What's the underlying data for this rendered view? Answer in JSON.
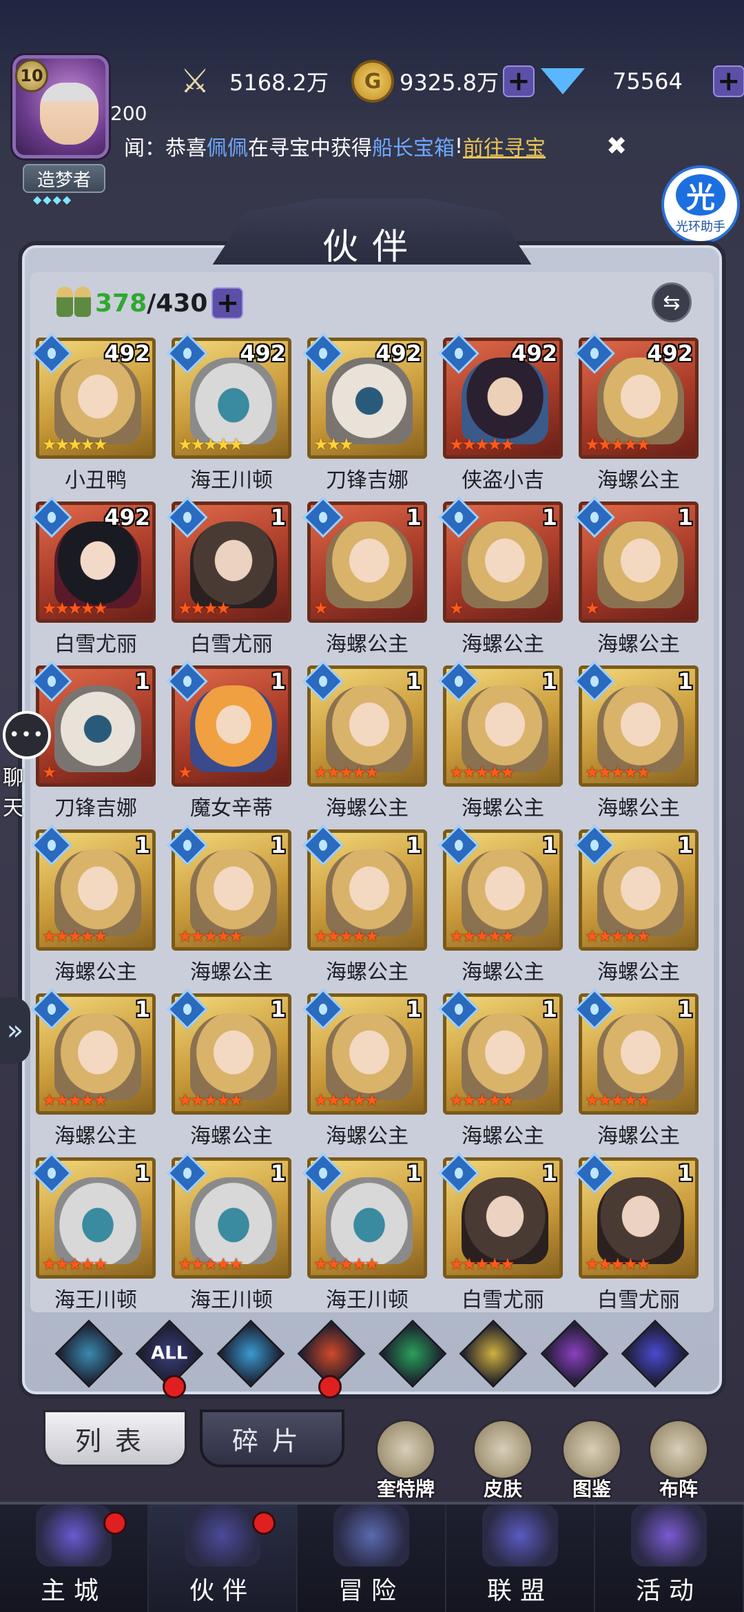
{
  "player": {
    "level": "10",
    "level_number": "200",
    "nickname": "造梦者",
    "rank_stars": "◆◆◆◆"
  },
  "resources": {
    "power": "5168.2万",
    "gold": "9325.8万",
    "diamonds": "75564"
  },
  "news": {
    "prefix": "闻：恭喜",
    "player": "佩佩",
    "mid": "在寻宝中获得",
    "item": "船长宝箱",
    "bang": "!",
    "link": "前往寻宝"
  },
  "helper": {
    "icon_text": "光",
    "label": "光环助手"
  },
  "page_title": "伙伴",
  "partner_count": {
    "current": "378",
    "max": "/430"
  },
  "partners": [
    {
      "name": "小丑鸭",
      "level": "492",
      "stars": 5,
      "star_color": "yellow",
      "frame": "gold",
      "portrait": "p-blonde"
    },
    {
      "name": "海王川顿",
      "level": "492",
      "stars": 5,
      "star_color": "yellow",
      "frame": "gold",
      "portrait": "p-white"
    },
    {
      "name": "刀锋吉娜",
      "level": "492",
      "stars": 3,
      "star_color": "yellow",
      "frame": "gold",
      "portrait": "p-mask"
    },
    {
      "name": "侠盗小吉",
      "level": "492",
      "stars": 5,
      "star_color": "orange",
      "frame": "red",
      "portrait": "p-dark"
    },
    {
      "name": "海螺公主",
      "level": "492",
      "stars": 5,
      "star_color": "orange",
      "frame": "red",
      "portrait": "p-blonde"
    },
    {
      "name": "白雪尤丽",
      "level": "492",
      "stars": 5,
      "star_color": "orange",
      "frame": "red",
      "portrait": "p-black"
    },
    {
      "name": "白雪尤丽",
      "level": "1",
      "stars": 4,
      "star_color": "orange",
      "frame": "red",
      "portrait": "p-brown"
    },
    {
      "name": "海螺公主",
      "level": "1",
      "stars": 1,
      "star_color": "orange",
      "frame": "red",
      "portrait": "p-blonde"
    },
    {
      "name": "海螺公主",
      "level": "1",
      "stars": 1,
      "star_color": "orange",
      "frame": "red",
      "portrait": "p-blonde"
    },
    {
      "name": "海螺公主",
      "level": "1",
      "stars": 1,
      "star_color": "orange",
      "frame": "red",
      "portrait": "p-blonde"
    },
    {
      "name": "刀锋吉娜",
      "level": "1",
      "stars": 1,
      "star_color": "orange",
      "frame": "red",
      "portrait": "p-mask"
    },
    {
      "name": "魔女辛蒂",
      "level": "1",
      "stars": 1,
      "star_color": "orange",
      "frame": "red",
      "portrait": "p-orange"
    },
    {
      "name": "海螺公主",
      "level": "1",
      "stars": 5,
      "star_color": "orange",
      "frame": "gold",
      "portrait": "p-blonde"
    },
    {
      "name": "海螺公主",
      "level": "1",
      "stars": 5,
      "star_color": "orange",
      "frame": "gold",
      "portrait": "p-blonde"
    },
    {
      "name": "海螺公主",
      "level": "1",
      "stars": 5,
      "star_color": "orange",
      "frame": "gold",
      "portrait": "p-blonde"
    },
    {
      "name": "海螺公主",
      "level": "1",
      "stars": 5,
      "star_color": "orange",
      "frame": "gold",
      "portrait": "p-blonde"
    },
    {
      "name": "海螺公主",
      "level": "1",
      "stars": 5,
      "star_color": "orange",
      "frame": "gold",
      "portrait": "p-blonde"
    },
    {
      "name": "海螺公主",
      "level": "1",
      "stars": 5,
      "star_color": "orange",
      "frame": "gold",
      "portrait": "p-blonde"
    },
    {
      "name": "海螺公主",
      "level": "1",
      "stars": 5,
      "star_color": "orange",
      "frame": "gold",
      "portrait": "p-blonde"
    },
    {
      "name": "海螺公主",
      "level": "1",
      "stars": 5,
      "star_color": "orange",
      "frame": "gold",
      "portrait": "p-blonde"
    },
    {
      "name": "海螺公主",
      "level": "1",
      "stars": 5,
      "star_color": "orange",
      "frame": "gold",
      "portrait": "p-blonde"
    },
    {
      "name": "海螺公主",
      "level": "1",
      "stars": 5,
      "star_color": "orange",
      "frame": "gold",
      "portrait": "p-blonde"
    },
    {
      "name": "海螺公主",
      "level": "1",
      "stars": 5,
      "star_color": "orange",
      "frame": "gold",
      "portrait": "p-blonde"
    },
    {
      "name": "海螺公主",
      "level": "1",
      "stars": 5,
      "star_color": "orange",
      "frame": "gold",
      "portrait": "p-blonde"
    },
    {
      "name": "海螺公主",
      "level": "1",
      "stars": 5,
      "star_color": "orange",
      "frame": "gold",
      "portrait": "p-blonde"
    },
    {
      "name": "海王川顿",
      "level": "1",
      "stars": 5,
      "star_color": "orange",
      "frame": "gold",
      "portrait": "p-white"
    },
    {
      "name": "海王川顿",
      "level": "1",
      "stars": 5,
      "star_color": "orange",
      "frame": "gold",
      "portrait": "p-white"
    },
    {
      "name": "海王川顿",
      "level": "1",
      "stars": 5,
      "star_color": "orange",
      "frame": "gold",
      "portrait": "p-white"
    },
    {
      "name": "白雪尤丽",
      "level": "1",
      "stars": 5,
      "star_color": "orange",
      "frame": "gold",
      "portrait": "p-brown"
    },
    {
      "name": "白雪尤丽",
      "level": "1",
      "stars": 5,
      "star_color": "orange",
      "frame": "gold",
      "portrait": "p-brown"
    }
  ],
  "side": {
    "chat_label": "聊天"
  },
  "filters": [
    {
      "key": "faction-filter",
      "label": "",
      "color": "#3a8ab0"
    },
    {
      "key": "all-filter",
      "label": "ALL",
      "color": "#3a3f7a"
    },
    {
      "key": "water-filter",
      "label": "",
      "color": "#3a9ad0"
    },
    {
      "key": "fire-filter",
      "label": "",
      "color": "#d04a2a"
    },
    {
      "key": "wind-filter",
      "label": "",
      "color": "#2aa05a"
    },
    {
      "key": "light-filter",
      "label": "",
      "color": "#d0b040"
    },
    {
      "key": "dark-filter",
      "label": "",
      "color": "#8a40c0"
    },
    {
      "key": "cosmic-filter",
      "label": "",
      "color": "#4a4ad0"
    }
  ],
  "tabs": {
    "list": "列表",
    "fragments": "碎片"
  },
  "tools": [
    "奎特牌",
    "皮肤",
    "图鉴",
    "布阵"
  ],
  "nav": [
    {
      "label": "主城",
      "dot": true,
      "color": "#6a5ad0"
    },
    {
      "label": "伙伴",
      "dot": true,
      "color": "#4a4a9a"
    },
    {
      "label": "冒险",
      "dot": false,
      "color": "#5a6ab0"
    },
    {
      "label": "联盟",
      "dot": false,
      "color": "#5a5ac0"
    },
    {
      "label": "活动",
      "dot": false,
      "color": "#7a5ad0"
    }
  ]
}
